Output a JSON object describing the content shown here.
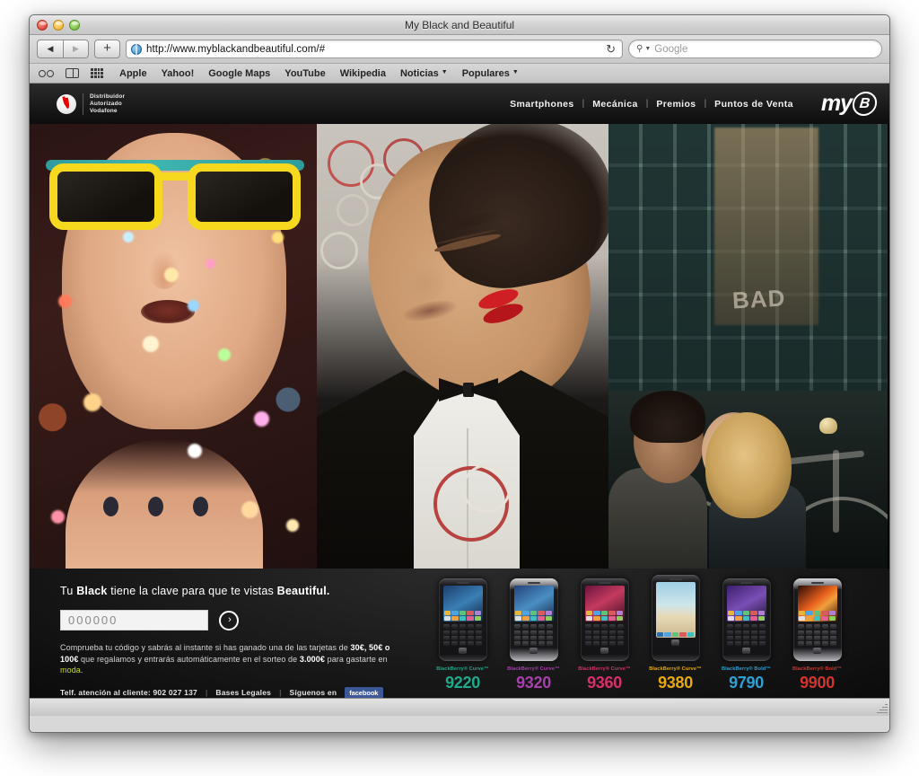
{
  "window": {
    "title": "My Black and Beautiful",
    "traffic_lights": [
      "close",
      "minimize",
      "zoom"
    ]
  },
  "toolbar": {
    "back_label": "◀",
    "forward_label": "▶",
    "add_tab_label": "+",
    "url": "http://www.myblackandbeautiful.com/#",
    "reload_label": "↻",
    "search_placeholder": "Google",
    "search_value": ""
  },
  "bookmarks": {
    "icons": [
      "reading-list-glasses-icon",
      "bookmarks-book-icon",
      "top-sites-grid-icon"
    ],
    "items": [
      {
        "label": "Apple",
        "has_menu": false
      },
      {
        "label": "Yahoo!",
        "has_menu": false
      },
      {
        "label": "Google Maps",
        "has_menu": false
      },
      {
        "label": "YouTube",
        "has_menu": false
      },
      {
        "label": "Wikipedia",
        "has_menu": false
      },
      {
        "label": "Noticias",
        "has_menu": true
      },
      {
        "label": "Populares",
        "has_menu": true
      }
    ]
  },
  "site": {
    "brand": {
      "line1": "Distribuidor",
      "line2": "Autorizado",
      "line3": "Vodafone",
      "mark_color": "#e60000"
    },
    "nav": [
      {
        "label": "Smartphones"
      },
      {
        "label": "Mecánica"
      },
      {
        "label": "Premios"
      },
      {
        "label": "Puntos de Venta"
      }
    ],
    "nav_separator": "|",
    "logo": {
      "my": "my",
      "b": "B"
    }
  },
  "hero": {
    "panels": [
      {
        "name": "confetti-girl",
        "alt": "Mujer con gafas de sol amarillas soplando confeti"
      },
      {
        "name": "tuxedo-man",
        "alt": "Hombre con esmoquin y marca de carmín en la mejilla"
      },
      {
        "name": "kissing-couple",
        "alt": "Pareja besándose junto a una bicicleta en la calle"
      }
    ]
  },
  "promo": {
    "heading_pre": "Tu ",
    "heading_black": "Black",
    "heading_mid": " tiene la clave para que te vistas ",
    "heading_beautiful": "Beautiful.",
    "code_value": "000000",
    "code_placeholder": "000000",
    "submit_label": "›",
    "body_1": "Comprueba tu código y sabrás al instante si has ganado una de las tarjetas de ",
    "body_amounts": "30€, 50€ o 100€",
    "body_2": " que regalamos y entrarás automáticamente en el sorteo de ",
    "body_prize": "3.000€",
    "body_3": " para gastarte en ",
    "body_moda": "moda",
    "body_end": ".",
    "moda_color": "#c9dd2a",
    "footer_phone_label": "Telf. atención al cliente: ",
    "footer_phone": "902 027 137",
    "footer_legal": "Bases Legales",
    "footer_follow": "Síguenos en",
    "footer_facebook": "facebook",
    "facebook_color": "#3b5998",
    "separator": "|"
  },
  "phones": [
    {
      "brand": "BlackBerry® Curve™",
      "model": "9220",
      "color": "#1fa98a",
      "body": "black",
      "style": "qwerty",
      "wall": "blue"
    },
    {
      "brand": "BlackBerry® Curve™",
      "model": "9320",
      "color": "#a83fae",
      "body": "silver",
      "style": "qwerty",
      "wall": "blue"
    },
    {
      "brand": "BlackBerry® Curve™",
      "model": "9360",
      "color": "#d6306b",
      "body": "black",
      "style": "qwerty",
      "wall": "red"
    },
    {
      "brand": "BlackBerry® Curve™",
      "model": "9380",
      "color": "#e8a80f",
      "body": "black",
      "style": "touch",
      "wall": "sky"
    },
    {
      "brand": "BlackBerry® Bold™",
      "model": "9790",
      "color": "#2f9fd4",
      "body": "black",
      "style": "qwerty",
      "wall": "purple"
    },
    {
      "brand": "BlackBerry® Bold™",
      "model": "9900",
      "color": "#d3342b",
      "body": "silver",
      "style": "qwerty",
      "wall": "orange"
    }
  ]
}
